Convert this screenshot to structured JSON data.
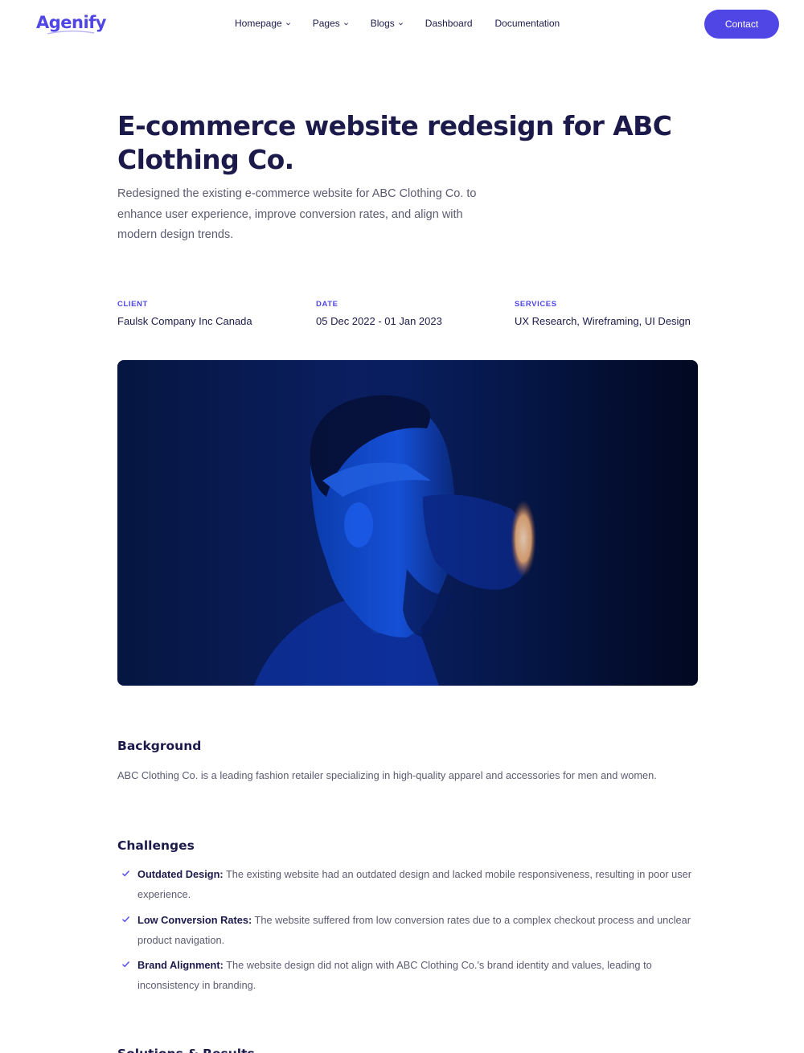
{
  "header": {
    "logo": "Agenify",
    "nav": [
      {
        "label": "Homepage",
        "has_dropdown": true
      },
      {
        "label": "Pages",
        "has_dropdown": true
      },
      {
        "label": "Blogs",
        "has_dropdown": true
      },
      {
        "label": "Dashboard",
        "has_dropdown": false
      },
      {
        "label": "Documentation",
        "has_dropdown": false
      }
    ],
    "contact_label": "Contact"
  },
  "hero": {
    "title": "E-commerce website redesign for ABC Clothing Co.",
    "subtitle": "Redesigned the existing e-commerce website for ABC Clothing Co. to enhance user experience, improve conversion rates, and align with modern design trends."
  },
  "meta": {
    "client_label": "CLIENT",
    "client_value": "Faulsk Company Inc Canada",
    "date_label": "DATE",
    "date_value": "05 Dec 2022 - 01 Jan 2023",
    "services_label": "SERVICES",
    "services_value": "UX Research, Wireframing, UI Design"
  },
  "background": {
    "heading": "Background",
    "text": "ABC Clothing Co. is a leading fashion retailer specializing in high-quality apparel and accessories for men and women."
  },
  "challenges": {
    "heading": "Challenges",
    "items": [
      {
        "title": "Outdated Design:",
        "text": "The existing website had an outdated design and lacked mobile responsiveness, resulting in poor user experience."
      },
      {
        "title": "Low Conversion Rates:",
        "text": "The website suffered from low conversion rates due to a complex checkout process and unclear product navigation."
      },
      {
        "title": "Brand Alignment:",
        "text": "The website design did not align with ABC Clothing Co.'s brand identity and values, leading to inconsistency in branding."
      }
    ]
  },
  "next_section": {
    "heading": "Solutions & Results"
  },
  "colors": {
    "accent": "#4f46e5",
    "heading": "#1c1a4b",
    "body_text": "#5b5b72"
  }
}
